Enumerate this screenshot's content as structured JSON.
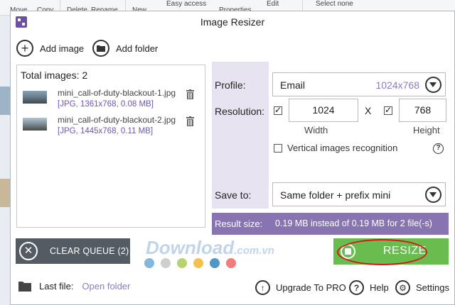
{
  "ribbon": {
    "items": [
      "Move",
      "Copy",
      "Delete",
      "Rename",
      "New",
      "Easy access",
      "Properties",
      "Edit",
      "Select none"
    ]
  },
  "window": {
    "title": "Image Resizer"
  },
  "toolbar": {
    "add_image": "Add image",
    "add_folder": "Add folder"
  },
  "file_list": {
    "total_label": "Total images: 2",
    "files": [
      {
        "name": "mini_call-of-duty-blackout-1.jpg",
        "meta": "[JPG, 1361x768, 0.08 MB]"
      },
      {
        "name": "mini_call-of-duty-blackout-2.jpg",
        "meta": "[JPG, 1445x768, 0.11 MB]"
      }
    ]
  },
  "settings": {
    "profile_label": "Profile:",
    "profile_value": "Email",
    "profile_dims": "1024x768",
    "resolution_label": "Resolution:",
    "width_value": "1024",
    "height_value": "768",
    "separator": "X",
    "width_caption": "Width",
    "height_caption": "Height",
    "vertical_label": "Vertical images recognition",
    "help": "?",
    "save_label": "Save to:",
    "save_value": "Same folder + prefix mini",
    "result_label": "Result size:",
    "result_value": "0.19 MB instead of 0.19 MB for 2 file(-s)",
    "width_checked": true,
    "height_checked": true,
    "vertical_checked": false
  },
  "actions": {
    "clear_queue": "CLEAR QUEUE (2)",
    "resize": "RESIZE"
  },
  "watermark": {
    "main": "Download",
    "suffix": ".com.vn"
  },
  "color_dots": [
    "#82b7de",
    "#cfcfcf",
    "#b7d26f",
    "#f3c14c",
    "#4f97cb",
    "#f07d79"
  ],
  "footer": {
    "last_file_label": "Last file:",
    "open_folder": "Open folder",
    "upgrade": "Upgrade To PRO",
    "help": "Help",
    "settings": "Settings"
  },
  "colors": {
    "accent_purple": "#8874b0",
    "resize_green": "#69bc4e",
    "clear_gray": "#555b63",
    "highlight_red": "#d8141c"
  }
}
